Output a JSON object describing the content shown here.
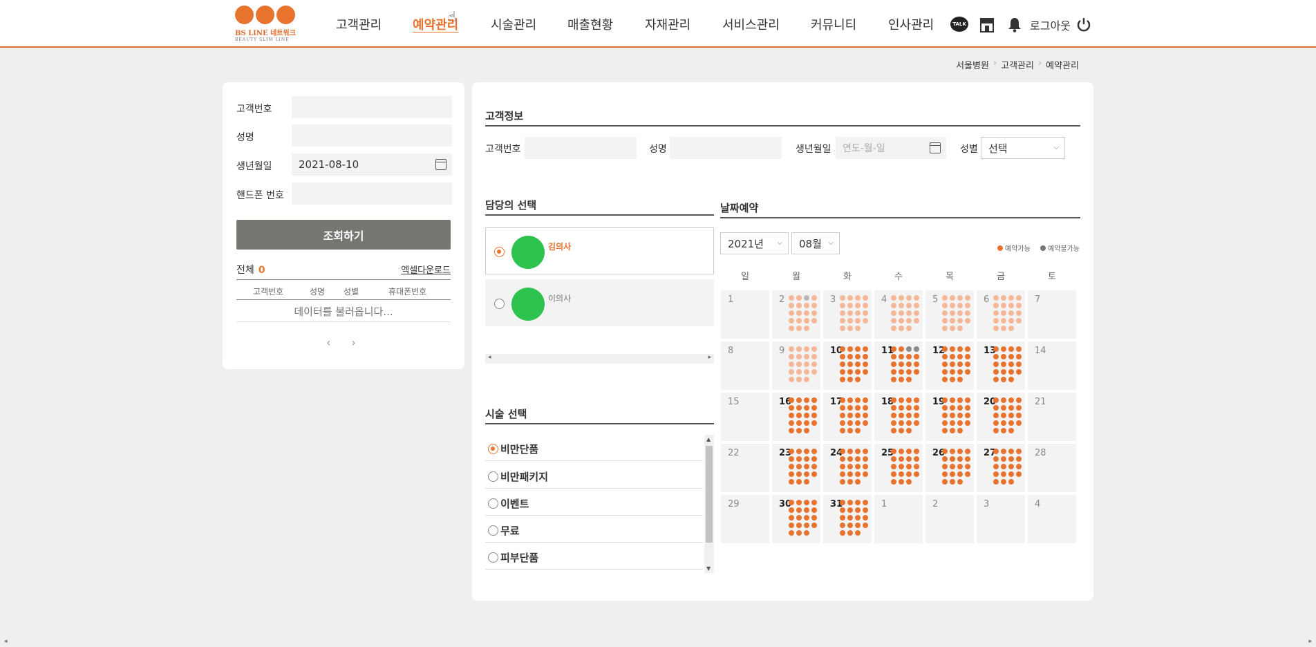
{
  "header": {
    "logo": {
      "title": "BS LINE 네트워크",
      "subtitle": "BEAUTY SLIM LINE"
    },
    "nav": [
      {
        "label": "고객관리",
        "active": false
      },
      {
        "label": "예약관리",
        "active": true
      },
      {
        "label": "시술관리",
        "active": false
      },
      {
        "label": "매출현황",
        "active": false
      },
      {
        "label": "자재관리",
        "active": false
      },
      {
        "label": "서비스관리",
        "active": false
      },
      {
        "label": "커뮤니티",
        "active": false
      },
      {
        "label": "인사관리",
        "active": false
      }
    ],
    "talk_label": "TALK",
    "logout_label": "로그아웃",
    "icons": [
      "kakaotalk-icon",
      "store-icon",
      "bell-icon",
      "power-icon"
    ]
  },
  "breadcrumb": [
    "서울병원",
    "고객관리",
    "예약관리"
  ],
  "search_panel": {
    "fields": [
      {
        "label": "고객번호",
        "value": ""
      },
      {
        "label": "성명",
        "value": ""
      },
      {
        "label": "생년월일",
        "value": "2021-08-10"
      },
      {
        "label": "핸드폰 번호",
        "value": ""
      }
    ],
    "search_button": "조회하기",
    "total_label": "전체",
    "total_count": "0",
    "excel_label": "엑셀다운로드",
    "columns": [
      "고객번호",
      "성명",
      "성별",
      "휴대폰번호"
    ],
    "loading_text": "데이터를 불러옵니다..."
  },
  "customer_info": {
    "title": "고객정보",
    "customer_no_label": "고객번호",
    "name_label": "성명",
    "birth_label": "생년월일",
    "birth_placeholder": "연도-월-일",
    "gender_label": "성별",
    "gender_value": "선택"
  },
  "doctor_select": {
    "title": "담당의 선택",
    "doctors": [
      {
        "name": "김의사",
        "selected": true
      },
      {
        "name": "이의사",
        "selected": false
      }
    ]
  },
  "service_select": {
    "title": "시술 선택",
    "items": [
      {
        "label": "비만단품",
        "selected": true
      },
      {
        "label": "비만패키지",
        "selected": false
      },
      {
        "label": "이벤트",
        "selected": false
      },
      {
        "label": "무료",
        "selected": false
      },
      {
        "label": "피부단품",
        "selected": false
      }
    ]
  },
  "date_reservation": {
    "title": "날짜예약",
    "year": "2021년",
    "month": "08월",
    "legend": {
      "available": "예약가능",
      "unavailable": "예약불가능",
      "available_color": "#e8732f",
      "unavailable_color": "#777777"
    },
    "weekdays": [
      "일",
      "월",
      "화",
      "수",
      "목",
      "금",
      "토"
    ],
    "weeks": [
      [
        {
          "d": "1",
          "s": "none"
        },
        {
          "d": "2",
          "s": "past",
          "full": [
            2
          ]
        },
        {
          "d": "3",
          "s": "past"
        },
        {
          "d": "4",
          "s": "past"
        },
        {
          "d": "5",
          "s": "past"
        },
        {
          "d": "6",
          "s": "past"
        },
        {
          "d": "7",
          "s": "none"
        }
      ],
      [
        {
          "d": "8",
          "s": "none"
        },
        {
          "d": "9",
          "s": "past"
        },
        {
          "d": "10",
          "s": "open"
        },
        {
          "d": "11",
          "s": "open",
          "full": [
            2,
            3
          ]
        },
        {
          "d": "12",
          "s": "open"
        },
        {
          "d": "13",
          "s": "open"
        },
        {
          "d": "14",
          "s": "none"
        }
      ],
      [
        {
          "d": "15",
          "s": "none"
        },
        {
          "d": "16",
          "s": "open"
        },
        {
          "d": "17",
          "s": "open"
        },
        {
          "d": "18",
          "s": "open"
        },
        {
          "d": "19",
          "s": "open"
        },
        {
          "d": "20",
          "s": "open"
        },
        {
          "d": "21",
          "s": "none"
        }
      ],
      [
        {
          "d": "22",
          "s": "none"
        },
        {
          "d": "23",
          "s": "open"
        },
        {
          "d": "24",
          "s": "open"
        },
        {
          "d": "25",
          "s": "open"
        },
        {
          "d": "26",
          "s": "open"
        },
        {
          "d": "27",
          "s": "open"
        },
        {
          "d": "28",
          "s": "none"
        }
      ],
      [
        {
          "d": "29",
          "s": "none"
        },
        {
          "d": "30",
          "s": "open"
        },
        {
          "d": "31",
          "s": "open"
        },
        {
          "d": "1",
          "s": "none"
        },
        {
          "d": "2",
          "s": "none"
        },
        {
          "d": "3",
          "s": "none"
        },
        {
          "d": "4",
          "s": "none"
        }
      ]
    ]
  }
}
